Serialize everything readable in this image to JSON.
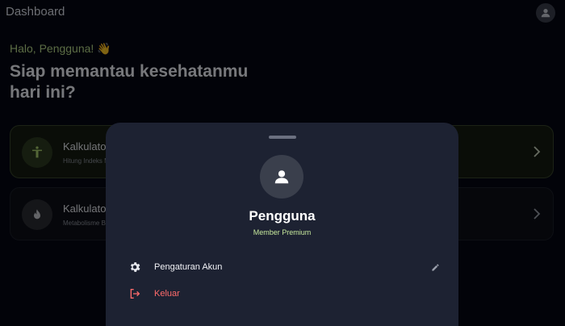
{
  "appbar": {
    "title": "Dashboard"
  },
  "greeting": "Halo, Pengguna! 👋",
  "headline": "Siap memantau kesehatanmu hari ini?",
  "cards": [
    {
      "title": "Kalkulator BMI",
      "subtitle": "Hitung Indeks Massa Tubuh",
      "icon": "accessibility-icon"
    },
    {
      "title": "Kalkulator BMR",
      "subtitle": "Metabolisme Basal",
      "icon": "flame-icon"
    }
  ],
  "sheet": {
    "name": "Pengguna",
    "badge": "Member Premium",
    "menu": [
      {
        "label": "Pengaturan Akun",
        "icon": "gear-icon"
      },
      {
        "label": "Keluar",
        "icon": "logout-icon"
      }
    ]
  },
  "colors": {
    "background": "#050712",
    "sheet": "#1d2232",
    "accent_green": "#b7d98a",
    "danger": "#ff6b6b"
  }
}
